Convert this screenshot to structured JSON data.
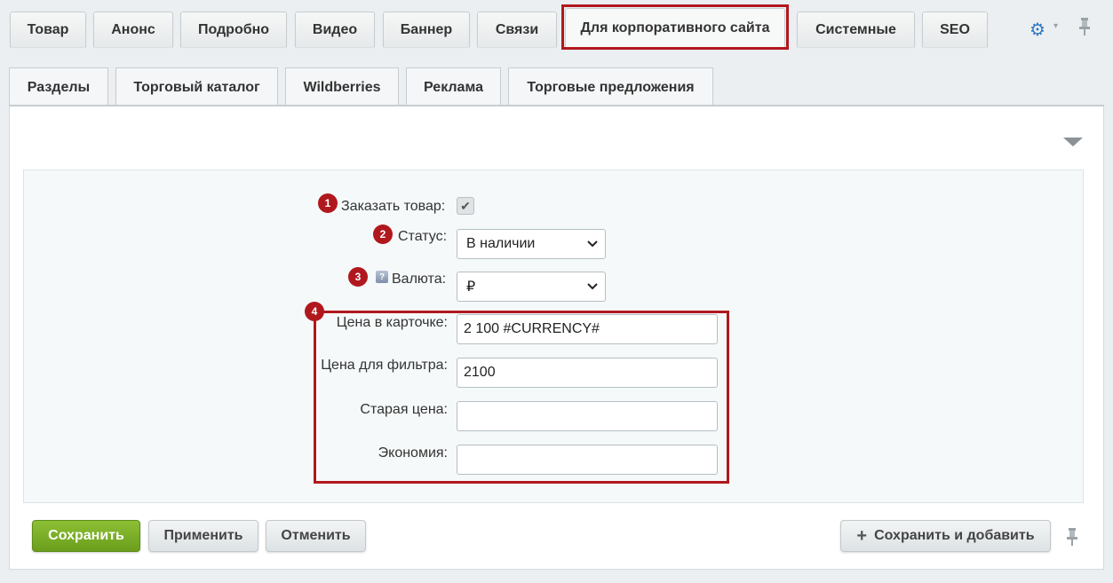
{
  "top_tabs": [
    {
      "label": "Товар"
    },
    {
      "label": "Анонс"
    },
    {
      "label": "Подробно"
    },
    {
      "label": "Видео"
    },
    {
      "label": "Баннер"
    },
    {
      "label": "Связи"
    },
    {
      "label": "Для корпоративного сайта",
      "active": true
    },
    {
      "label": "Системные"
    },
    {
      "label": "SEO"
    }
  ],
  "sub_tabs": [
    {
      "label": "Разделы"
    },
    {
      "label": "Торговый каталог"
    },
    {
      "label": "Wildberries"
    },
    {
      "label": "Реклама"
    },
    {
      "label": "Торговые предложения"
    }
  ],
  "form": {
    "order": {
      "num": "1",
      "label": "Заказать товар:",
      "checked": true,
      "check_glyph": "✔"
    },
    "status": {
      "num": "2",
      "label": "Статус:",
      "value": "В наличии"
    },
    "currency": {
      "num": "3",
      "help": "?",
      "label": "Валюта:",
      "value": "₽"
    },
    "group_num": "4",
    "price_card": {
      "label": "Цена в карточке:",
      "value": "2 100 #CURRENCY#"
    },
    "price_filter": {
      "label": "Цена для фильтра:",
      "value": "2100"
    },
    "old_price": {
      "label": "Старая цена:",
      "value": ""
    },
    "savings": {
      "label": "Экономия:",
      "value": ""
    }
  },
  "buttons": {
    "save": "Сохранить",
    "apply": "Применить",
    "cancel": "Отменить",
    "save_add": "Сохранить и добавить"
  },
  "icons": {
    "plus": "+",
    "gear": "⚙",
    "caret": "▾",
    "pin": "📌",
    "select_arrow": "⌄"
  },
  "colors": {
    "highlight": "#b0181e",
    "save_button": "#7aad24"
  }
}
